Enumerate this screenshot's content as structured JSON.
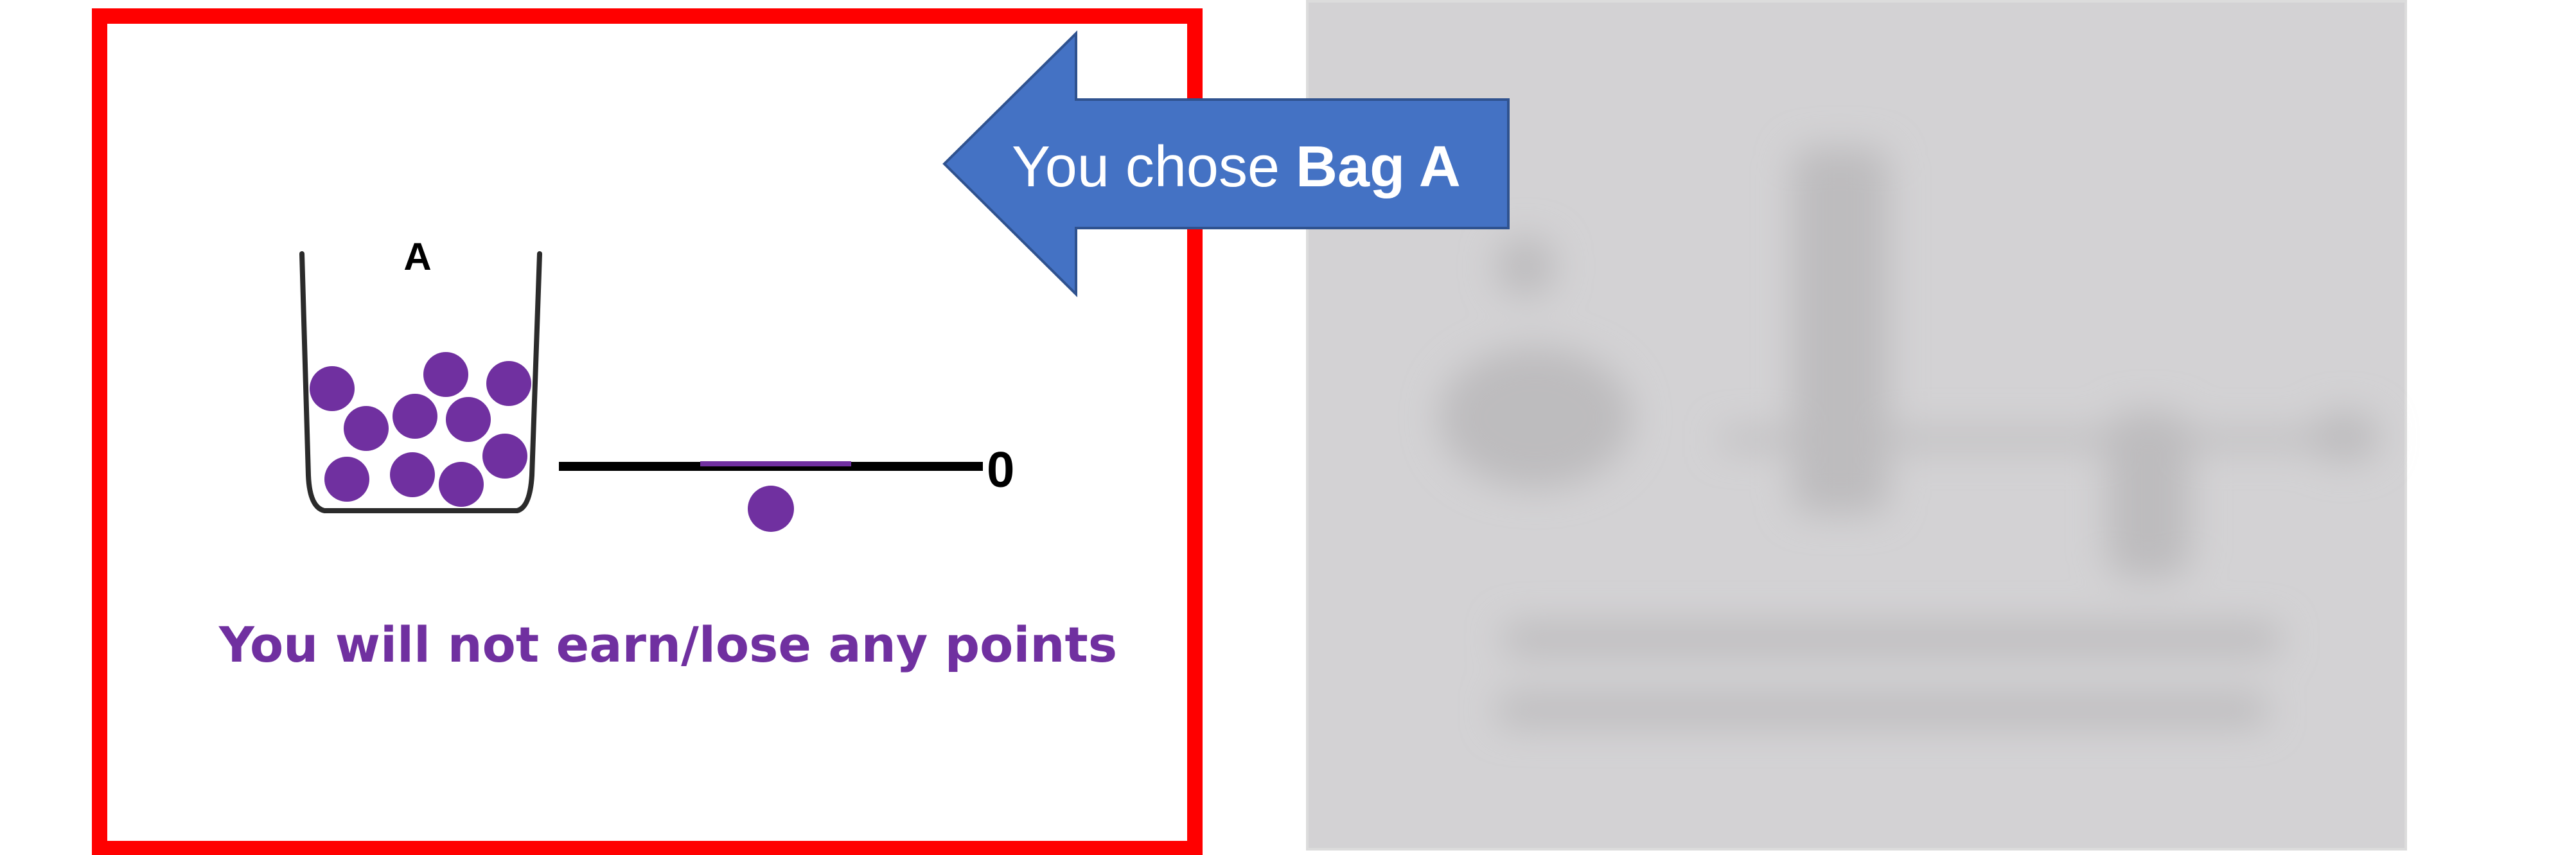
{
  "left_panel": {
    "bag_label": "A",
    "scale_value": "0",
    "result_text": "You will not earn/lose any points"
  },
  "arrow_callout": {
    "prefix": "You chose ",
    "choice": "Bag A"
  },
  "right_panel": {
    "state": "blurred"
  },
  "colors": {
    "highlight_border": "#ff0000",
    "marble": "#7030a0",
    "result_text": "#7030a0",
    "scale_line": "#000000",
    "scale_marker": "#7030a0",
    "arrow_fill": "#4472c4",
    "arrow_stroke": "#2f528f",
    "blurred_panel": "#d3d2d4"
  }
}
